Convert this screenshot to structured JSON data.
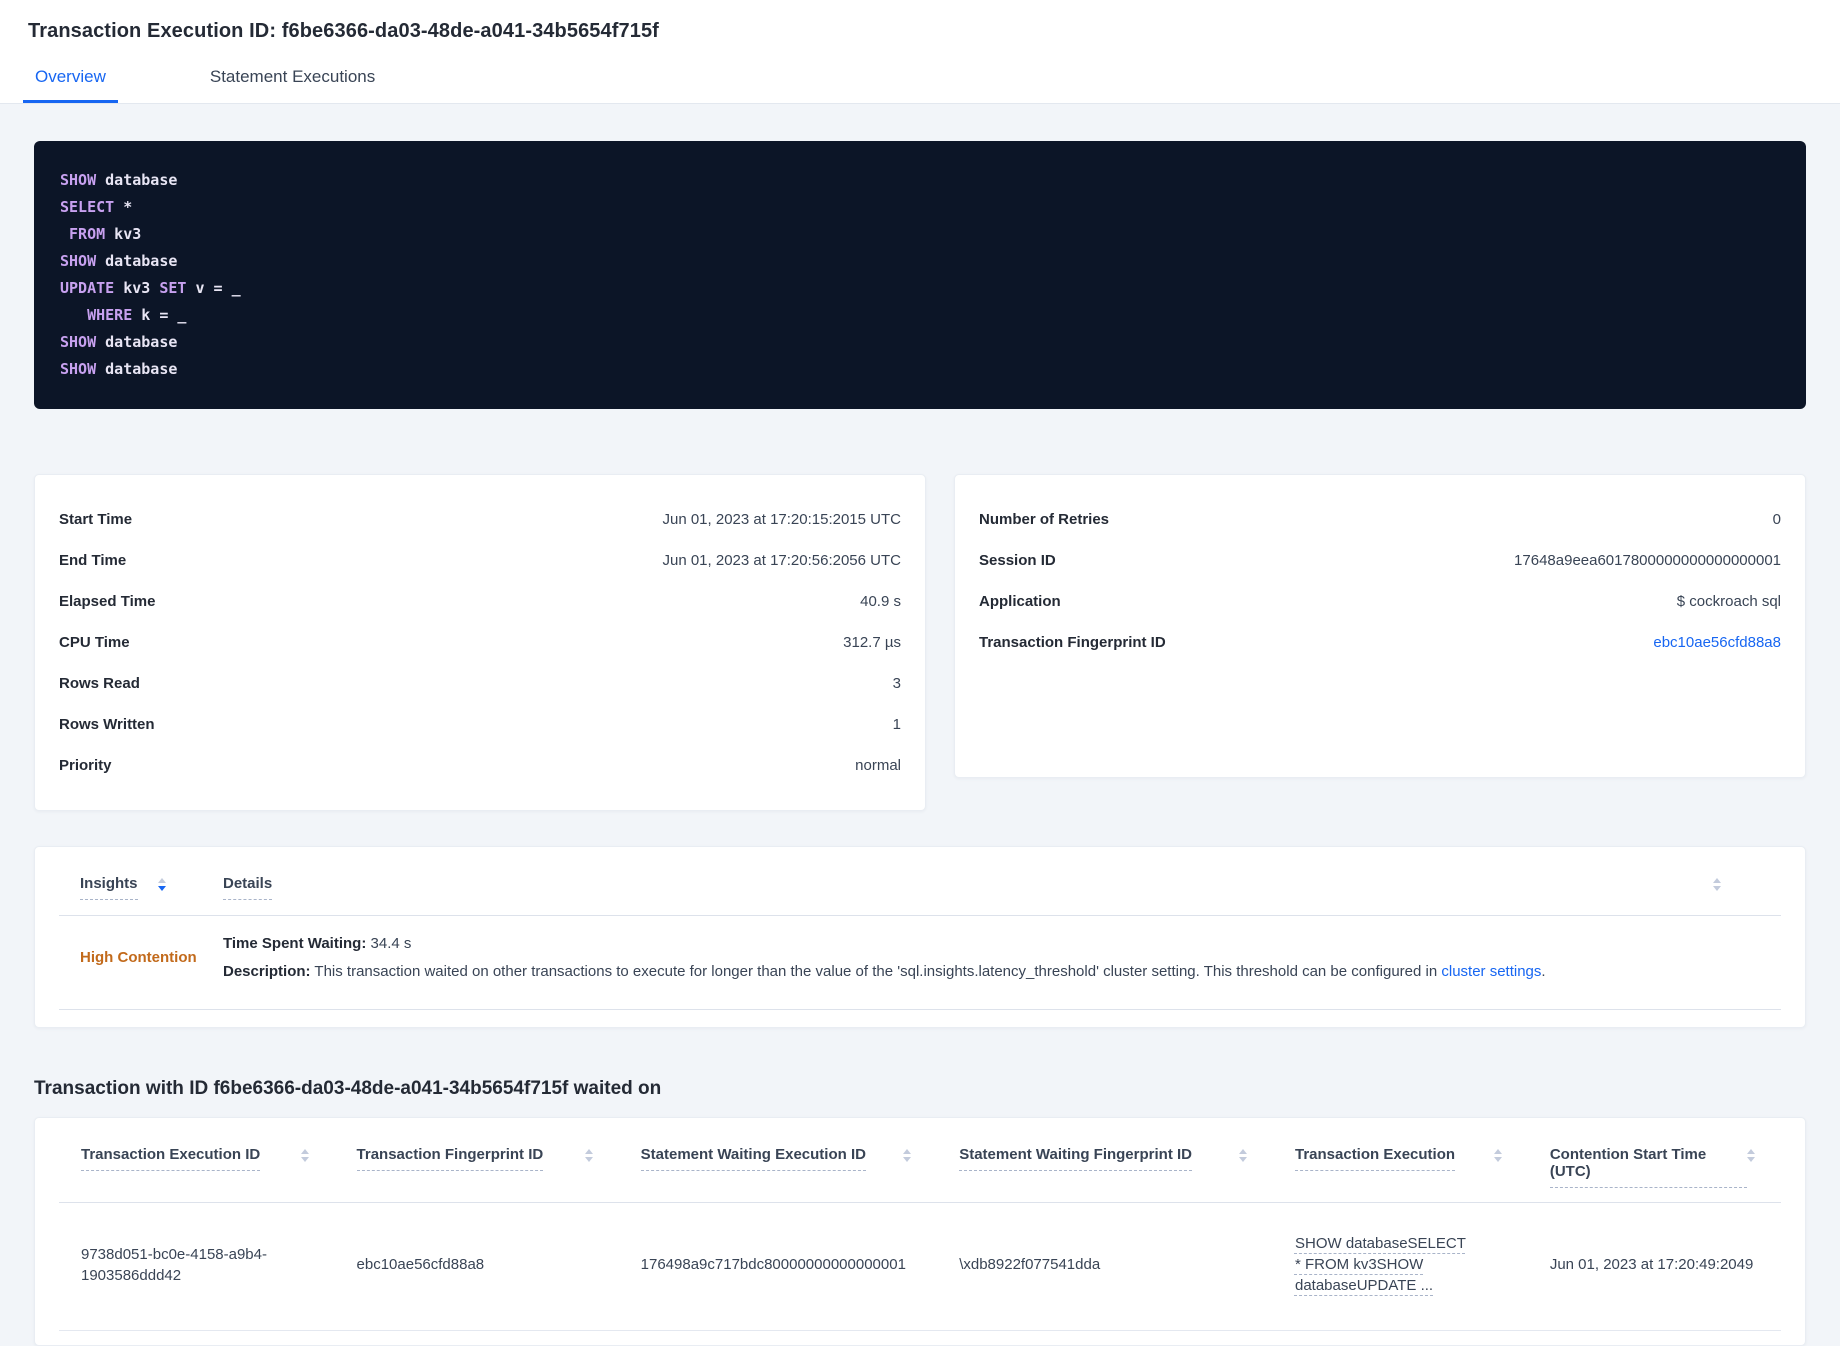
{
  "colors": {
    "accent_blue": "#1766F2",
    "insight_orange": "#C26A1B",
    "code_background": "#0C1527",
    "code_keyword": "#C8A1F0",
    "page_background": "#F2F5F9"
  },
  "header": {
    "title": "Transaction Execution ID: f6be6366-da03-48de-a041-34b5654f715f",
    "tabs": [
      {
        "label": "Overview",
        "active": true
      },
      {
        "label": "Statement Executions",
        "active": false
      }
    ]
  },
  "sql": {
    "lines": [
      [
        {
          "t": "SHOW"
        },
        {
          "t": " database"
        }
      ],
      [
        {
          "t": "SELECT"
        },
        {
          "t": " *"
        }
      ],
      [
        {
          "t": " "
        },
        {
          "t": "FROM"
        },
        {
          "t": " kv3"
        }
      ],
      [
        {
          "t": "SHOW"
        },
        {
          "t": " database"
        }
      ],
      [
        {
          "t": "UPDATE"
        },
        {
          "t": " kv3 "
        },
        {
          "t": "SET"
        },
        {
          "t": " v = _"
        }
      ],
      [
        {
          "t": "   "
        },
        {
          "t": "WHERE"
        },
        {
          "t": " k = _"
        }
      ],
      [
        {
          "t": "SHOW"
        },
        {
          "t": " database"
        }
      ],
      [
        {
          "t": "SHOW"
        },
        {
          "t": " database"
        }
      ]
    ]
  },
  "summary_left": {
    "rows": [
      {
        "label": "Start Time",
        "value": "Jun 01, 2023 at 17:20:15:2015 UTC"
      },
      {
        "label": "End Time",
        "value": "Jun 01, 2023 at 17:20:56:2056 UTC"
      },
      {
        "label": "Elapsed Time",
        "value": "40.9 s"
      },
      {
        "label": "CPU Time",
        "value": "312.7 µs"
      },
      {
        "label": "Rows Read",
        "value": "3"
      },
      {
        "label": "Rows Written",
        "value": "1"
      },
      {
        "label": "Priority",
        "value": "normal"
      }
    ]
  },
  "summary_right": {
    "rows": [
      {
        "label": "Number of Retries",
        "value": "0"
      },
      {
        "label": "Session ID",
        "value": "17648a9eea6017800000000000000001"
      },
      {
        "label": "Application",
        "value": "$ cockroach sql"
      },
      {
        "label": "Transaction Fingerprint ID",
        "value": "ebc10ae56cfd88a8"
      }
    ]
  },
  "insights": {
    "columns": {
      "insights": "Insights",
      "details": "Details"
    },
    "row": {
      "badge": "High Contention",
      "waiting_label": "Time Spent Waiting:",
      "waiting_value": " 34.4 s",
      "description_label": "Description:",
      "description_text": " This transaction waited on other transactions to execute for longer than the value of the 'sql.insights.latency_threshold' cluster setting. This threshold can be configured in ",
      "description_link": "cluster settings",
      "description_suffix": "."
    }
  },
  "waited_on": {
    "heading": "Transaction with ID f6be6366-da03-48de-a041-34b5654f715f waited on",
    "columns": [
      "Transaction Execution ID",
      "Transaction Fingerprint ID",
      "Statement Waiting Execution ID",
      "Statement Waiting Fingerprint ID",
      "Transaction Execution",
      "Contention Start Time (UTC)"
    ],
    "rows": [
      {
        "txn_exec_id": "9738d051-bc0e-4158-a9b4-1903586ddd42",
        "txn_fingerprint_id": "ebc10ae56cfd88a8",
        "stmt_exec_id": "176498a9c717bdc80000000000000001",
        "stmt_fingerprint_id": "\\xdb8922f077541dda",
        "txn_execution": "SHOW databaseSELECT * FROM kv3SHOW databaseUPDATE ...",
        "contention_start": "Jun 01, 2023 at 17:20:49:2049"
      }
    ]
  }
}
